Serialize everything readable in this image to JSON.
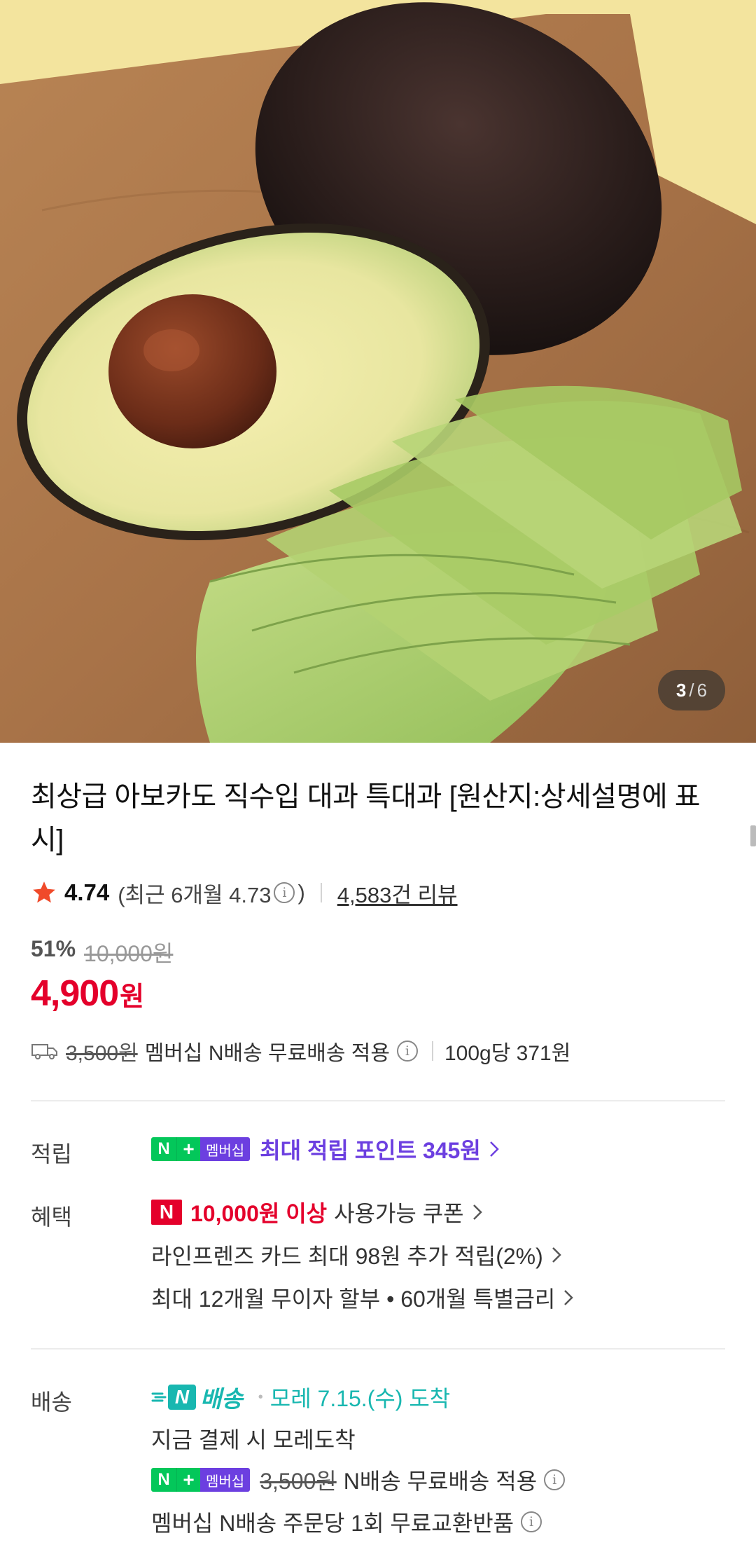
{
  "gallery": {
    "current": "3",
    "separator": "/",
    "total": "6"
  },
  "product": {
    "title": "최상급 아보카도 직수입 대과 특대과 [원산지:상세설명에 표시]",
    "rating": "4.74",
    "recent_prefix": "(최근 6개월 4.73",
    "recent_suffix": ")",
    "review_count": "4,583건 리뷰",
    "discount": "51%",
    "original_price": "10,000원",
    "price": "4,900",
    "price_unit": "원"
  },
  "shipping_summary": {
    "fee": "3,500원",
    "text": "멤버십 N배송 무료배송 적용",
    "unit_price": "100g당 371원"
  },
  "points": {
    "label": "적립",
    "badge_n": "N",
    "badge_plus": "+",
    "badge_member": "멤버십",
    "text": "최대 적립 포인트 345원"
  },
  "benefits": {
    "label": "혜택",
    "coupon_badge": "N",
    "coupon_amount": "10,000원 이상",
    "coupon_text": "사용가능 쿠폰",
    "card_text": "라인프렌즈 카드 최대 98원 추가 적립(2%)",
    "installment_text": "최대 12개월 무이자 할부 • 60개월 특별금리"
  },
  "delivery": {
    "label": "배송",
    "badge_n": "N",
    "badge_text": "배송",
    "separator": "•",
    "arrival": "모레 7.15.(수) 도착",
    "pay_now": "지금 결제 시 모레도착",
    "fee": "3,500원",
    "free_text": "N배송 무료배송 적용",
    "exchange_text": "멤버십 N배송 주문당 1회 무료교환반품"
  },
  "colors": {
    "price_red": "#e4002b",
    "naver_green": "#03c75a",
    "member_purple": "#6c3fe0",
    "delivery_teal": "#18b7b0"
  }
}
